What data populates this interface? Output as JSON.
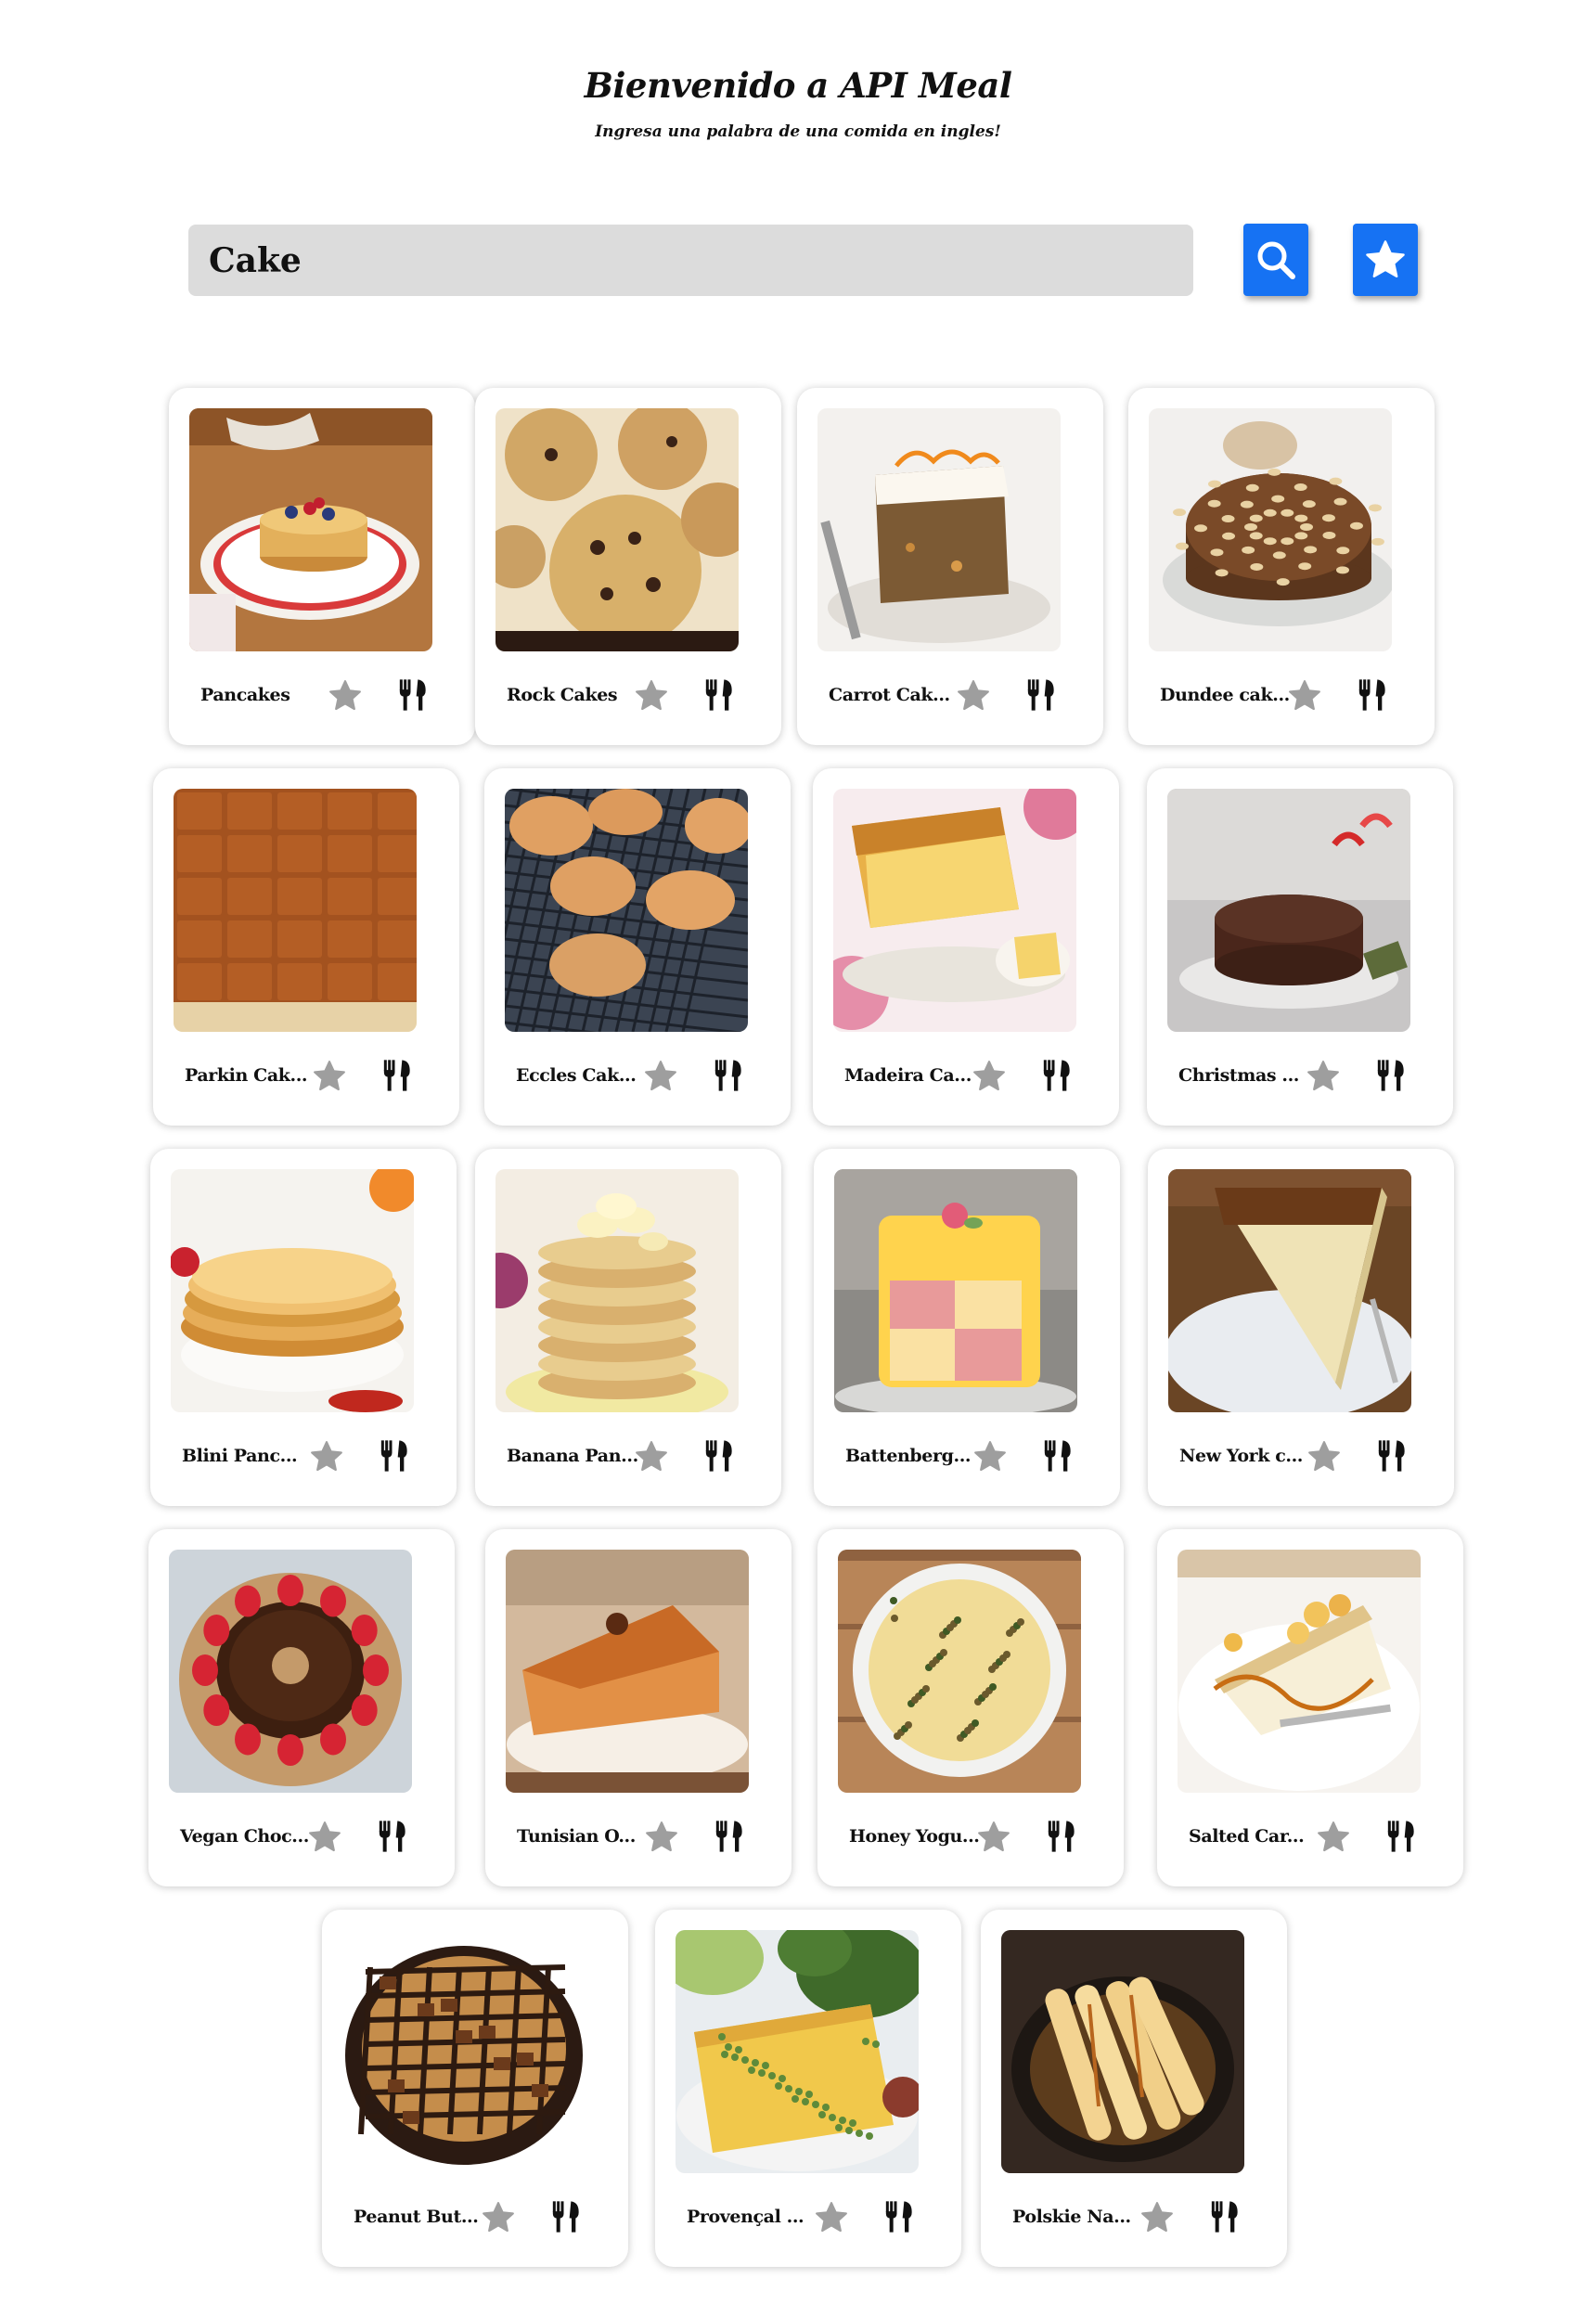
{
  "header": {
    "title": "Bienvenido a API Meal",
    "subtitle": "Ingresa una palabra de una comida en ingles!"
  },
  "search": {
    "value": "Cake",
    "search_icon": "search-icon",
    "favorites_icon": "star-icon",
    "accent_color": "#1672f3"
  },
  "icons": {
    "favorite": "star-icon",
    "recipe": "fork-knife-icon",
    "favorite_color": "#9e9e9e"
  },
  "meals": [
    {
      "name": "Pancakes"
    },
    {
      "name": "Rock Cakes"
    },
    {
      "name": "Carrot Cak..."
    },
    {
      "name": "Dundee cak..."
    },
    {
      "name": "Parkin Cak..."
    },
    {
      "name": "Eccles Cak..."
    },
    {
      "name": "Madeira Ca..."
    },
    {
      "name": "Christmas ..."
    },
    {
      "name": "Blini Panc..."
    },
    {
      "name": "Banana Pan..."
    },
    {
      "name": "Battenberg..."
    },
    {
      "name": "New York c..."
    },
    {
      "name": "Vegan Choc..."
    },
    {
      "name": "Tunisian O..."
    },
    {
      "name": "Honey Yogu..."
    },
    {
      "name": "Salted Car..."
    },
    {
      "name": "Peanut But..."
    },
    {
      "name": "Provençal ..."
    },
    {
      "name": "Polskie Na..."
    }
  ]
}
